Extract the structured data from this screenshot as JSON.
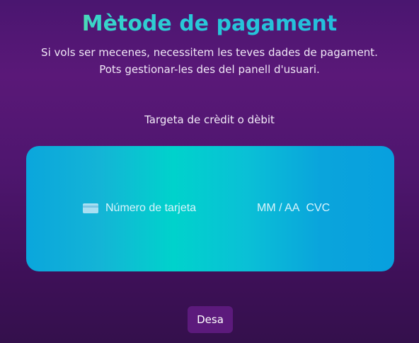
{
  "page": {
    "title": "Mètode de pagament",
    "description": "Si vols ser mecenes, necessitem les teves dades de pagament. Pots gestionar-les des del panell d'usuari."
  },
  "payment": {
    "section_label": "Targeta de crèdit o dèbit",
    "card_icon": "credit-card-icon",
    "card_number_placeholder": "Número de tarjeta",
    "expiry_placeholder": "MM / AA",
    "cvc_placeholder": "CVC"
  },
  "actions": {
    "save_label": "Desa"
  },
  "colors": {
    "background": "#4a1670",
    "card_gradient_start": "#0aa6dc",
    "card_gradient_mid": "#00d2cc",
    "button": "#5c1a7c",
    "title_start": "#e8ff3a",
    "title_end": "#22b8de"
  }
}
